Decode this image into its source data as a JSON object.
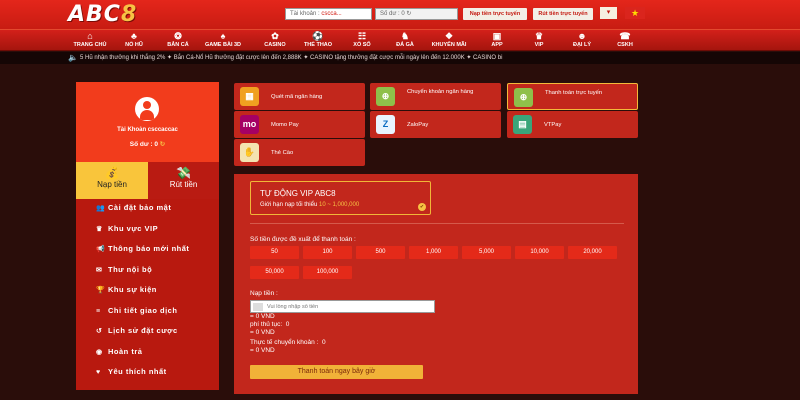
{
  "header": {
    "logo_main": "ABC",
    "logo_num": "8",
    "account_label": "Tài khoản :",
    "account_value": "cscca...",
    "balance_label": "Số dư :",
    "balance_value": "0",
    "btn_deposit_fast": "Nạp tiền trực tuyến",
    "btn_withdraw_fast": "Rút tiền trực tuyến",
    "flag_symbol": "★"
  },
  "nav": [
    {
      "label": "TRANG CHỦ",
      "icon": "home-icon",
      "glyph": "⌂"
    },
    {
      "label": "NỔ HŨ",
      "icon": "slot-icon",
      "glyph": "♣"
    },
    {
      "label": "BẮN CÁ",
      "icon": "fish-icon",
      "glyph": "❂"
    },
    {
      "label": "GAME BÀI 3D",
      "icon": "cards-icon",
      "glyph": "♠"
    },
    {
      "label": "CASINO",
      "icon": "casino-icon",
      "glyph": "✿"
    },
    {
      "label": "THỂ THAO",
      "icon": "sports-icon",
      "glyph": "⚽"
    },
    {
      "label": "XỔ SỐ",
      "icon": "lottery-icon",
      "glyph": "☷"
    },
    {
      "label": "ĐÁ GÀ",
      "icon": "cockfight-icon",
      "glyph": "♞"
    },
    {
      "label": "KHUYẾN MÃI",
      "icon": "gift-icon",
      "glyph": "❖"
    },
    {
      "label": "APP",
      "icon": "app-icon",
      "glyph": "▣"
    },
    {
      "label": "VIP",
      "icon": "crown-icon",
      "glyph": "♛"
    },
    {
      "label": "ĐẠI LÝ",
      "icon": "agent-icon",
      "glyph": "☻"
    },
    {
      "label": "CSKH",
      "icon": "support-icon",
      "glyph": "☎"
    }
  ],
  "ticker": "5 Hũ nhận thưởng khi thắng 2%  ✦ Bắn Cá-Nổ Hũ thưởng đặt cược lên đến 2,888K  ✦ CASINO tặng thưởng đặt cược mỗi ngày lên đến 12.000K  ✦ CASINO bi",
  "profile": {
    "account_text": "Tài Khoản csccaccac",
    "balance_label": "Số dư :",
    "balance_value": "0",
    "refresh_glyph": "↻"
  },
  "tabs": {
    "deposit": "Nạp tiền",
    "withdraw": "Rút tiền"
  },
  "menu": [
    {
      "label": "Cài đặt bảo mật",
      "glyph": "👥"
    },
    {
      "label": "Khu vực VIP",
      "glyph": "♛"
    },
    {
      "label": "Thông báo mới nhất",
      "glyph": "📢"
    },
    {
      "label": "Thư nội bộ",
      "glyph": "✉"
    },
    {
      "label": "Khu sự kiện",
      "glyph": "🏆"
    },
    {
      "label": "Chi tiết giao dịch",
      "glyph": "≡"
    },
    {
      "label": "Lịch sử đặt cược",
      "glyph": "↺"
    },
    {
      "label": "Hoàn trả",
      "glyph": "◉"
    },
    {
      "label": "Yêu thích nhất",
      "glyph": "♥"
    }
  ],
  "methods": [
    {
      "label": "Quét mã ngân hàng",
      "icon": "qr-bank-icon",
      "glyph": "▦",
      "icon_bg": "#f0a020",
      "icon_fg": "#fff"
    },
    {
      "label": "Chuyển khoản ngân hàng",
      "icon": "bank-transfer-icon",
      "glyph": "⊕",
      "icon_bg": "#8fc04a",
      "icon_fg": "#fff"
    },
    {
      "label": "Thanh toán trực tuyến",
      "icon": "online-pay-icon",
      "glyph": "⊕",
      "icon_bg": "#8fc04a",
      "icon_fg": "#fff"
    },
    {
      "label": "Momo Pay",
      "icon": "momo-icon",
      "glyph": "mo",
      "icon_bg": "#a50064",
      "icon_fg": "#fff"
    },
    {
      "label": "ZaloPay",
      "icon": "zalopay-icon",
      "glyph": "Z",
      "icon_bg": "#e8f4ff",
      "icon_fg": "#0a6cc2"
    },
    {
      "label": "VTPay",
      "icon": "vtpay-icon",
      "glyph": "▤",
      "icon_bg": "#3aa57a",
      "icon_fg": "#fff"
    },
    {
      "label": "Thẻ Cào",
      "icon": "scratch-card-icon",
      "glyph": "✋",
      "icon_bg": "#f4e3b0",
      "icon_fg": "#c47a00"
    }
  ],
  "vip": {
    "title": "TỰ ĐỘNG VIP ABC8",
    "limit_label": "Giới hạn nạp tối thiểu",
    "limit_value": "10 ~ 1,000,000",
    "check_glyph": "✔"
  },
  "suggest": {
    "title": "Số tiền được đề xuất để thanh toán :",
    "amounts": [
      "50",
      "100",
      "500",
      "1,000",
      "5,000",
      "10,000",
      "20,000",
      "50,000",
      "100,000"
    ]
  },
  "form": {
    "nap_label": "Nạp tiền :",
    "nap_placeholder": "Vui lòng nhập số tiền",
    "nap_vnd": "= 0 VND",
    "fee_label": "phí thủ tục:",
    "fee_value": "0",
    "fee_vnd": "= 0 VND",
    "actual_label": "Thực tế chuyển khoản :",
    "actual_value": "0",
    "actual_vnd": "= 0 VND",
    "submit_label": "Thanh toán ngay bây giờ"
  },
  "colors": {
    "brand_red": "#e4261b",
    "panel_red": "#c2271c",
    "gold": "#f1b238",
    "background": "#2a0d0a"
  }
}
